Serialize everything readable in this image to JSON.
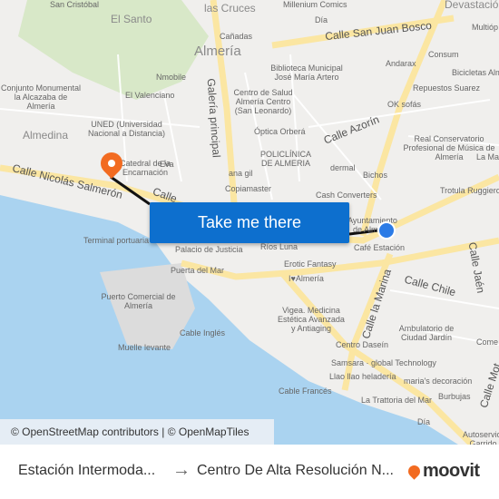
{
  "map": {
    "labels": [
      "San Cristóbal",
      "El Santo",
      "las Cruces",
      "Millenium Comics",
      "Devastación",
      "Almería",
      "Cañadas",
      "Día",
      "Calle San Juan Bosco",
      "Multióp",
      "Andarax",
      "Consum",
      "Nmobile",
      "Biblioteca Municipal José María Artero",
      "Repuestos Suarez",
      "Bicicletas Alm",
      "Conjunto Monumental la Alcazaba de Almería",
      "El Valenciano",
      "Galería principal",
      "OK sofás",
      "Centro de Salud Almería Centro (San Leonardo)",
      "UNED (Universidad Nacional a Distancia)",
      "Almedina",
      "Óptica Orberá",
      "Calle Azorín",
      "Real Conservatorio Profesional de Música de Almería",
      "Catedral de la Encarnación",
      "Eva",
      "POLICLÍNICA DE ALMERIA",
      "dermal",
      "Bichos",
      "La Ma",
      "ana gil",
      "Calle Nicolás Salmerón",
      "Copiamaster",
      "Cash Converters",
      "Trotula Ruggiero",
      "Calle",
      "Ayuntamiento de Almería",
      "Terminal portuaria",
      "Palacio de Justicia",
      "Ríos Luna",
      "Café Estación",
      "Calle Jaén",
      "Erotic Fantasy",
      "Puerta del Mar",
      "I♥Almería",
      "Calle Chile",
      "Puerto Comercial de Almería",
      "Calle la Marina",
      "Vigea. Medicina Estética Avanzada y Antiaging",
      "Ambulatorio de Ciudad Jardín",
      "Muelle levante",
      "Cable Inglés",
      "Centro Daseín",
      "Come",
      "Samsara · global Technology",
      "Llao llao heladería",
      "maria's decoración",
      "Cable Francés",
      "La Trattoria del Mar",
      "Burbujas",
      "Calle Mot",
      "Día",
      "Autoservicio Garrido"
    ],
    "attribution": "© OpenStreetMap contributors | © OpenMapTiles",
    "button_label": "Take me there",
    "colors": {
      "sea": "#aad3f0",
      "land": "#f0efed",
      "road": "#fbe6a2",
      "route": "#111111",
      "origin": "#2b7be6",
      "destination": "#f26b21",
      "button": "#0d6fce"
    }
  },
  "footer": {
    "from": "Estación Intermoda...",
    "arrow": "→",
    "to": "Centro De Alta Resolución N...",
    "logo": "moovit"
  }
}
